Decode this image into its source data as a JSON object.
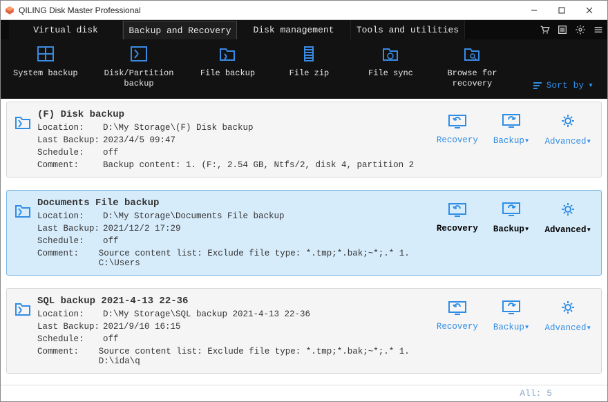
{
  "window": {
    "title": "QILING Disk Master Professional"
  },
  "tabs": [
    {
      "label": "Virtual disk"
    },
    {
      "label": "Backup and Recovery"
    },
    {
      "label": "Disk management"
    },
    {
      "label": "Tools and utilities"
    }
  ],
  "activeTabIndex": 1,
  "toolbar": [
    {
      "icon": "system-backup-icon",
      "label": "System backup"
    },
    {
      "icon": "disk-partition-backup-icon",
      "label": "Disk/Partition\nbackup"
    },
    {
      "icon": "file-backup-icon",
      "label": "File backup"
    },
    {
      "icon": "file-zip-icon",
      "label": "File zip"
    },
    {
      "icon": "file-sync-icon",
      "label": "File sync"
    },
    {
      "icon": "browse-for-recovery-icon",
      "label": "Browse for\nrecovery"
    }
  ],
  "sortByLabel": "Sort by",
  "fieldLabels": {
    "location": "Location:",
    "lastBackup": "Last Backup:",
    "schedule": "Schedule:",
    "comment": "Comment:"
  },
  "actionLabels": {
    "recovery": "Recovery",
    "backup": "Backup▾",
    "advanced": "Advanced▾"
  },
  "tasks": [
    {
      "name": "(F) Disk backup",
      "location": "D:\\My Storage\\(F) Disk backup",
      "lastBackup": "2023/4/5 09:47",
      "schedule": "off",
      "comment": "Backup content:  1. (F:, 2.54 GB, Ntfs/2, disk 4, partition 2",
      "selected": false
    },
    {
      "name": "Documents File backup",
      "location": "D:\\My Storage\\Documents File backup",
      "lastBackup": "2021/12/2 17:29",
      "schedule": "off",
      "comment": "Source content list:  Exclude file type: *.tmp;*.bak;~*;.*     1. C:\\Users",
      "selected": true
    },
    {
      "name": "SQL backup 2021-4-13 22-36",
      "location": "D:\\My Storage\\SQL backup 2021-4-13 22-36",
      "lastBackup": "2021/9/10 16:15",
      "schedule": "off",
      "comment": "Source content list:  Exclude file type: *.tmp;*.bak;~*;.*     1. D:\\ida\\q",
      "selected": false
    }
  ],
  "footer": {
    "countLabel": "All:  5"
  }
}
